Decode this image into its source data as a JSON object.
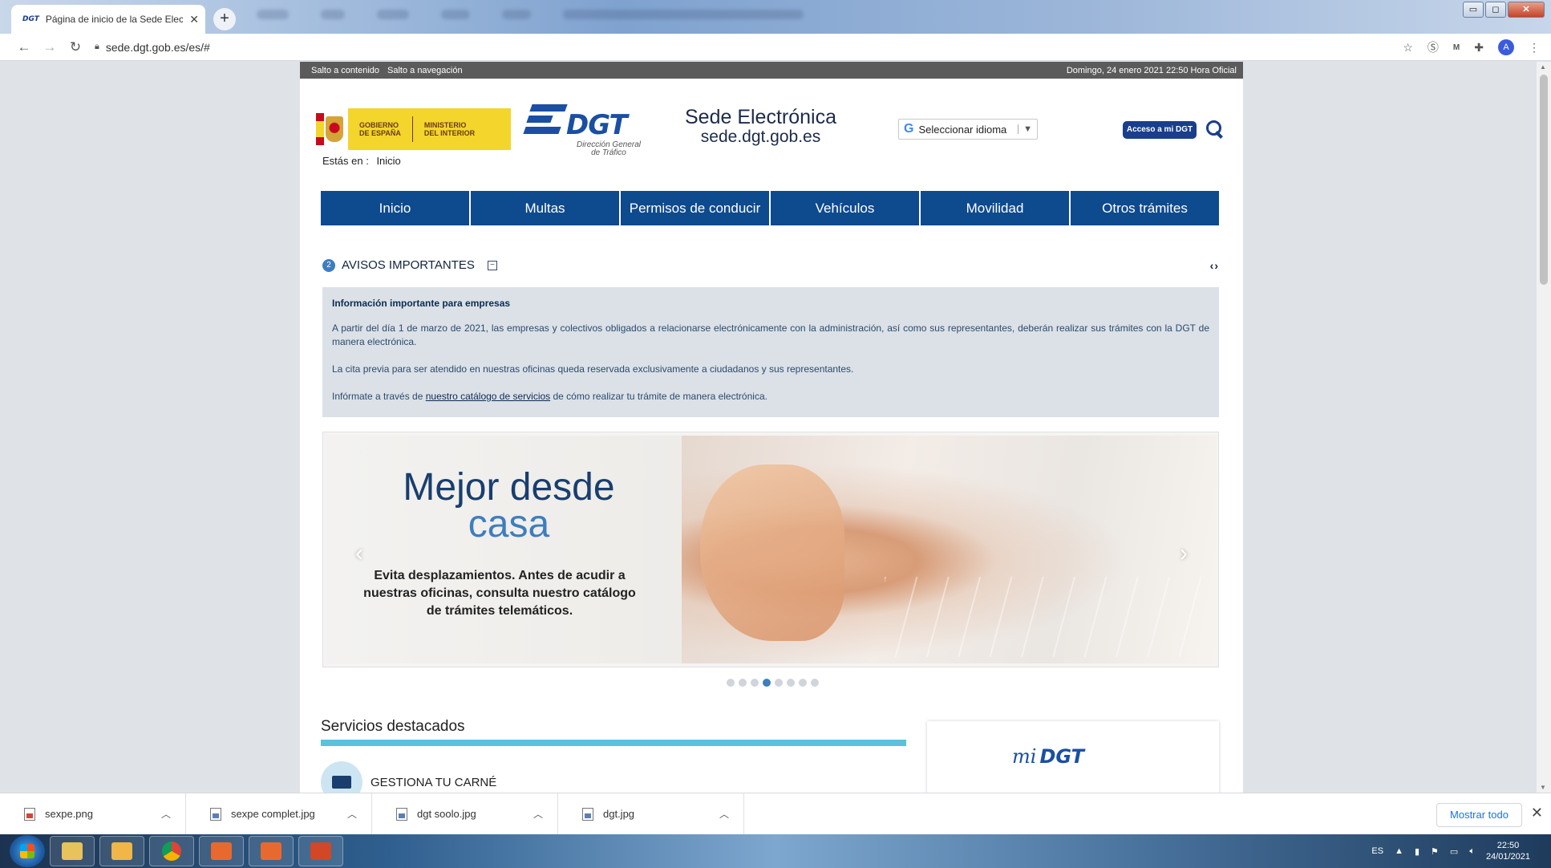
{
  "browser": {
    "tab_title": "Página de inicio de la Sede Electr",
    "tab_favicon": "DGT",
    "url": "sede.dgt.gob.es/es/#"
  },
  "page": {
    "skip_links": [
      "Salto a contenido",
      "Salto a navegación"
    ],
    "date_text": "Domingo, 24 enero 2021 22:50 Hora Oficial",
    "gob_logo": [
      "GOBIERNO\nDE ESPAÑA",
      "MINISTERIO\nDEL INTERIOR"
    ],
    "dgt_logo": {
      "word": "DGT",
      "sub": "Dirección General de Tráfico"
    },
    "sede": {
      "line1": "Sede Electrónica",
      "line2": "sede.dgt.gob.es"
    },
    "language_select": "Seleccionar idioma",
    "acceso_button": "Acceso a mi DGT",
    "breadcrumb": {
      "label": "Estás en :",
      "current": "Inicio"
    },
    "nav": [
      "Inicio",
      "Multas",
      "Permisos de conducir",
      "Vehículos",
      "Movilidad",
      "Otros trámites"
    ],
    "avisos": {
      "count": "2",
      "title": "AVISOS IMPORTANTES",
      "heading": "Información importante para empresas",
      "p1": "A partir del día 1 de marzo de 2021, las empresas y colectivos obligados a relacionarse electrónicamente con la administración, así como sus representantes, deberán realizar sus trámites con la DGT de manera electrónica.",
      "p2": "La cita previa para ser atendido en nuestras oficinas queda reservada exclusivamente a ciudadanos y sus representantes.",
      "p3_before": "Infórmate a través de ",
      "p3_link": "nuestro catálogo de servicios",
      "p3_after": " de cómo realizar tu trámite de manera electrónica."
    },
    "carousel": {
      "title_part1": "Mejor desde",
      "title_part2": "casa",
      "description": "Evita desplazamientos. Antes de acudir a nuestras oficinas, consulta nuestro catálogo de trámites telemáticos.",
      "slide_count": 8,
      "active_slide": 4
    },
    "servicios": {
      "title": "Servicios destacados",
      "first_item": "GESTIONA TU CARNÉ"
    },
    "midgt_card": {
      "prefix": "mi",
      "word": "DGT"
    }
  },
  "downloads": {
    "items": [
      "sexpe.png",
      "sexpe complet.jpg",
      "dgt soolo.jpg",
      "dgt.jpg"
    ],
    "show_all": "Mostrar todo"
  },
  "taskbar": {
    "lang": "ES",
    "time": "22:50",
    "date": "24/01/2021"
  }
}
